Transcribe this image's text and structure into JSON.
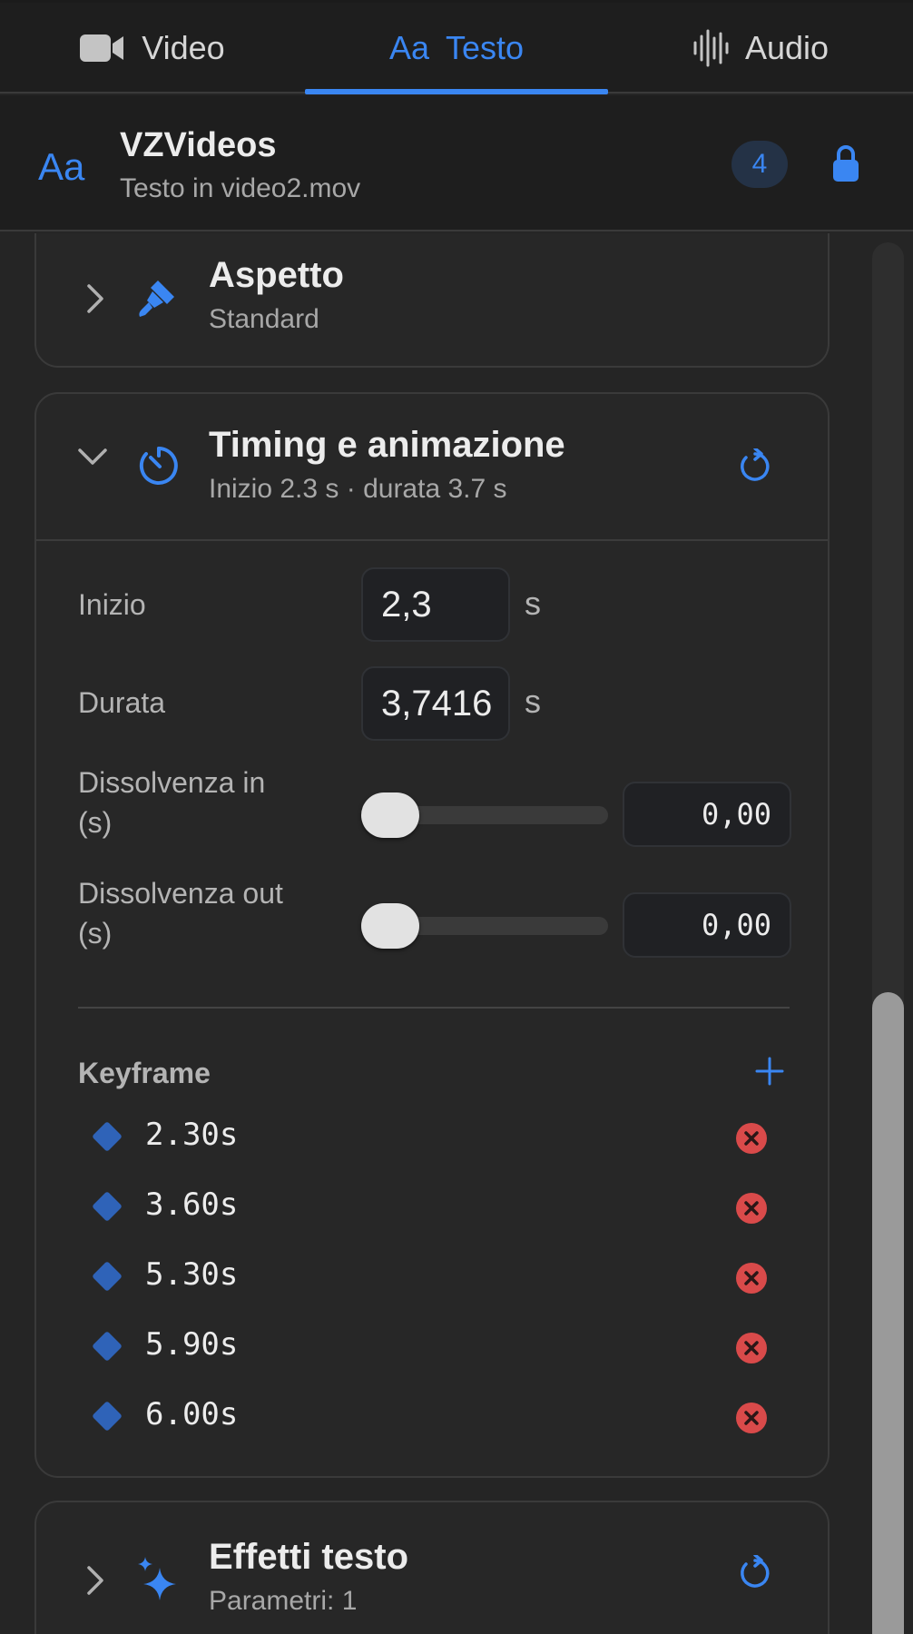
{
  "tabs": [
    {
      "label": "Video",
      "icon": "video-camera-icon",
      "active": false
    },
    {
      "label": "Testo",
      "prefix": "Aa",
      "icon": "text-aa-icon",
      "active": true
    },
    {
      "label": "Audio",
      "icon": "waveform-icon",
      "active": false
    }
  ],
  "header": {
    "icon_text": "Aa",
    "title": "VZVideos",
    "subtitle": "Testo in video2.mov",
    "badge_count": "4"
  },
  "sections": {
    "aspetto": {
      "title": "Aspetto",
      "subtitle": "Standard",
      "expanded": false,
      "icon": "paintbrush-icon"
    },
    "timing": {
      "title": "Timing e animazione",
      "subtitle": "Inizio 2.3 s · durata 3.7 s",
      "expanded": true,
      "icon": "timer-icon",
      "inizio": {
        "label": "Inizio",
        "value": "2,3",
        "unit": "s"
      },
      "durata": {
        "label": "Durata",
        "value": "3,7416",
        "unit": "s"
      },
      "fade_in": {
        "label_line1": "Dissolvenza in",
        "label_line2": "(s)",
        "value": "0,00",
        "slider_fraction": 0
      },
      "fade_out": {
        "label_line1": "Dissolvenza out",
        "label_line2": "(s)",
        "value": "0,00",
        "slider_fraction": 0
      },
      "keyframes": {
        "title": "Keyframe",
        "items": [
          "2.30s",
          "3.60s",
          "5.30s",
          "5.90s",
          "6.00s"
        ]
      }
    },
    "effetti": {
      "title": "Effetti testo",
      "subtitle": "Parametri: 1",
      "expanded": false,
      "icon": "sparkles-icon"
    }
  },
  "colors": {
    "accent": "#3a86f2",
    "delete": "#d94a4a",
    "keyframe": "#2f63b8",
    "background": "#252525"
  }
}
